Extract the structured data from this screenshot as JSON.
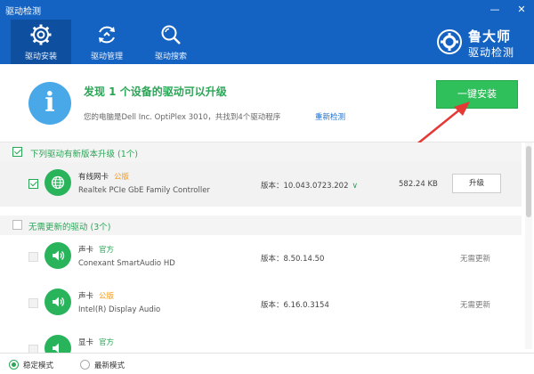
{
  "window": {
    "title": "驱动检测",
    "controls": {
      "minimize": "—",
      "close": "✕"
    }
  },
  "nav": {
    "tabs": [
      {
        "label": "驱动安装",
        "icon": "gear-icon",
        "active": true
      },
      {
        "label": "驱动管理",
        "icon": "refresh-icon",
        "active": false
      },
      {
        "label": "驱动搜索",
        "icon": "search-icon",
        "active": false
      }
    ]
  },
  "brand": {
    "line1": "鲁大师",
    "line2": "驱动检测"
  },
  "summary": {
    "headline": "发现 1 个设备的驱动可以升级",
    "subline": "您的电脑是Dell Inc. OptiPlex 3010，共找到4个驱动程序",
    "rescan": "重新检测",
    "install_button": "一键安装"
  },
  "sections": {
    "upgradable": {
      "label": "下列驱动有新版本升级 (1个)",
      "checked": true
    },
    "uptodate": {
      "label": "无需更新的驱动 (3个)",
      "checked": false
    }
  },
  "drivers_upgradable": [
    {
      "category": "有线网卡",
      "badge": "公版",
      "name": "Realtek PCIe GbE Family Controller",
      "version": "版本：10.043.0723.202",
      "size": "582.24 KB",
      "action": "升级",
      "checked": true,
      "icon": "globe-icon"
    }
  ],
  "drivers_uptodate": [
    {
      "category": "声卡",
      "badge": "官方",
      "name": "Conexant SmartAudio HD",
      "version": "版本：8.50.14.50",
      "status": "无需更新",
      "icon": "speaker-icon"
    },
    {
      "category": "声卡",
      "badge": "公版",
      "name": "Intel(R) Display Audio",
      "version": "版本：6.16.0.3154",
      "status": "无需更新",
      "icon": "speaker-icon"
    },
    {
      "category": "显卡",
      "badge": "官方",
      "name": "",
      "version": "",
      "status": "",
      "icon": "speaker-icon"
    }
  ],
  "footer": {
    "stable_mode": "稳定模式",
    "latest_mode": "最新模式",
    "selected": "stable"
  },
  "colors": {
    "brand_blue": "#1463c2",
    "accent_green": "#2aa656",
    "install_green": "#2fbf5b",
    "badge_orange": "#f59a1b",
    "arrow_red": "#e53935"
  }
}
